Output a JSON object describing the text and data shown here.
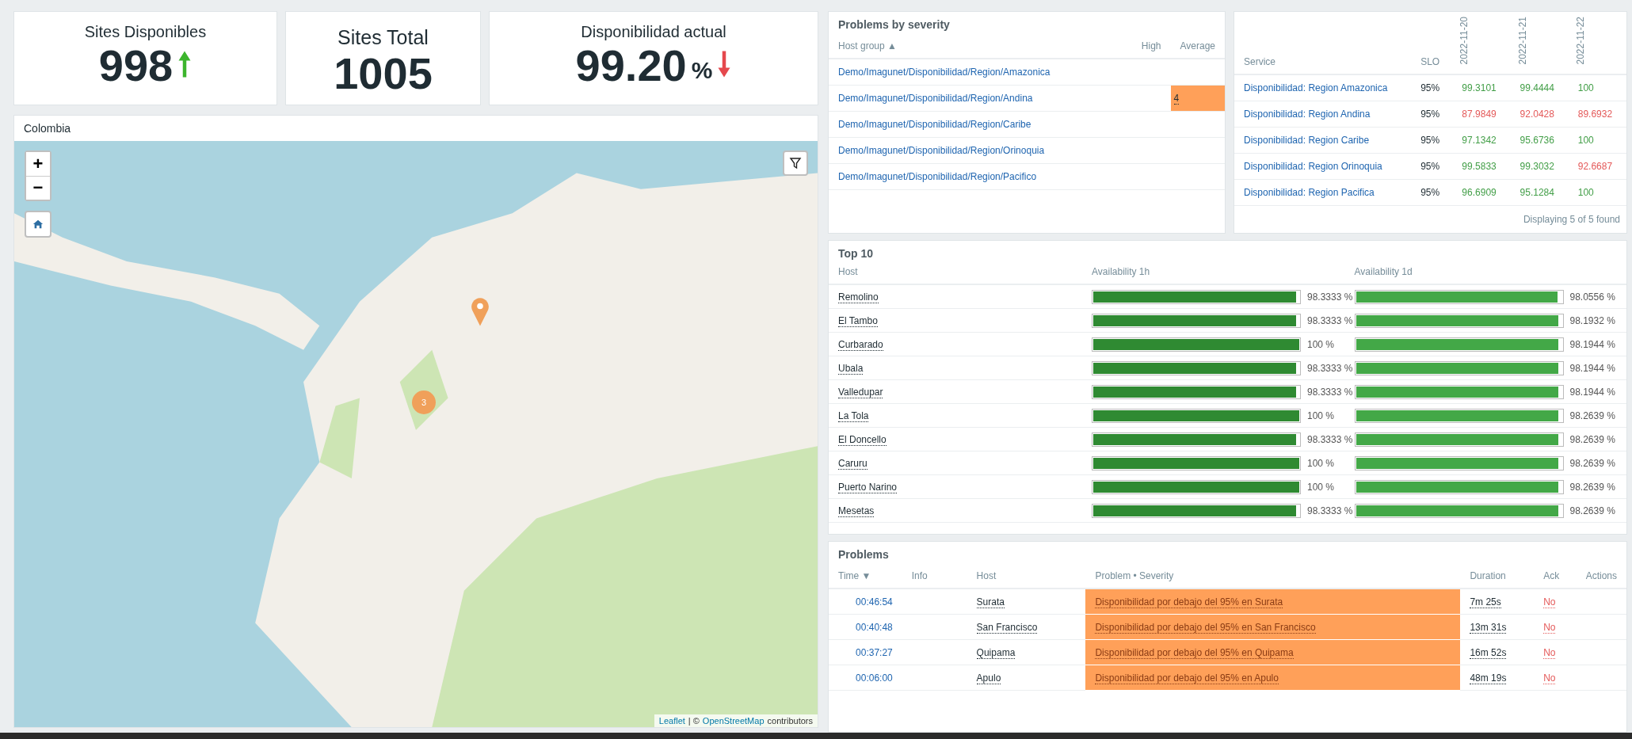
{
  "metrics": [
    {
      "title": "Sites Disponibles",
      "value": "998",
      "kind": "rising"
    },
    {
      "title": "Sites Total",
      "value": "1005",
      "kind": "plain"
    },
    {
      "title": "Disponibilidad actual",
      "value": "99.20",
      "unit": "%",
      "kind": "falling"
    }
  ],
  "map": {
    "title": "Colombia",
    "zoom_in": "+",
    "zoom_out": "−",
    "cluster_count": "3",
    "attribution_link": "Leaflet",
    "attribution_sep": "| ©",
    "attribution_osm": "OpenStreetMap",
    "attribution_rest": "contributors"
  },
  "problems_by_severity": {
    "title": "Problems by severity",
    "columns": [
      "Host group ▲",
      "High",
      "Average"
    ],
    "rows": [
      {
        "group": "Demo/Imagunet/Disponibilidad/Region/Amazonica"
      },
      {
        "group": "Demo/Imagunet/Disponibilidad/Region/Andina",
        "average": "4"
      },
      {
        "group": "Demo/Imagunet/Disponibilidad/Region/Caribe"
      },
      {
        "group": "Demo/Imagunet/Disponibilidad/Region/Orinoquia"
      },
      {
        "group": "Demo/Imagunet/Disponibilidad/Region/Pacifico"
      }
    ]
  },
  "sla": {
    "columns": [
      "Service",
      "SLO",
      "2022-11-20",
      "2022-11-21",
      "2022-11-22"
    ],
    "rows": [
      {
        "service": "Disponibilidad: Region Amazonica",
        "slo": "95%",
        "values": [
          {
            "text": "99.3101",
            "below_slo": false
          },
          {
            "text": "99.4444",
            "below_slo": false
          },
          {
            "text": "100",
            "below_slo": false
          }
        ]
      },
      {
        "service": "Disponibilidad: Region Andina",
        "slo": "95%",
        "values": [
          {
            "text": "87.9849",
            "below_slo": true
          },
          {
            "text": "92.0428",
            "below_slo": true
          },
          {
            "text": "89.6932",
            "below_slo": true
          }
        ]
      },
      {
        "service": "Disponibilidad: Region Caribe",
        "slo": "95%",
        "values": [
          {
            "text": "97.1342",
            "below_slo": false
          },
          {
            "text": "95.6736",
            "below_slo": false
          },
          {
            "text": "100",
            "below_slo": false
          }
        ]
      },
      {
        "service": "Disponibilidad: Region Orinoquia",
        "slo": "95%",
        "values": [
          {
            "text": "99.5833",
            "below_slo": false
          },
          {
            "text": "99.3032",
            "below_slo": false
          },
          {
            "text": "92.6687",
            "below_slo": true
          }
        ]
      },
      {
        "service": "Disponibilidad: Region Pacifica",
        "slo": "95%",
        "values": [
          {
            "text": "96.6909",
            "below_slo": false
          },
          {
            "text": "95.1284",
            "below_slo": false
          },
          {
            "text": "100",
            "below_slo": false
          }
        ]
      }
    ],
    "footer": "Displaying 5 of 5 found"
  },
  "top10": {
    "title": "Top 10",
    "columns": [
      "Host",
      "Availability 1h",
      "Availability 1d"
    ],
    "rows": [
      {
        "host": "Remolino",
        "h1": {
          "level": 0.983333,
          "text": "98.3333 %"
        },
        "d1": {
          "level": 0.980556,
          "text": "98.0556 %"
        }
      },
      {
        "host": "El Tambo",
        "h1": {
          "level": 0.983333,
          "text": "98.3333 %"
        },
        "d1": {
          "level": 0.981932,
          "text": "98.1932 %"
        }
      },
      {
        "host": "Curbarado",
        "h1": {
          "level": 1,
          "text": "100 %"
        },
        "d1": {
          "level": 0.981944,
          "text": "98.1944 %"
        }
      },
      {
        "host": "Ubala",
        "h1": {
          "level": 0.983333,
          "text": "98.3333 %"
        },
        "d1": {
          "level": 0.981944,
          "text": "98.1944 %"
        }
      },
      {
        "host": "Valledupar",
        "h1": {
          "level": 0.983333,
          "text": "98.3333 %"
        },
        "d1": {
          "level": 0.981944,
          "text": "98.1944 %"
        }
      },
      {
        "host": "La Tola",
        "h1": {
          "level": 1,
          "text": "100 %"
        },
        "d1": {
          "level": 0.982639,
          "text": "98.2639 %"
        }
      },
      {
        "host": "El Doncello",
        "h1": {
          "level": 0.983333,
          "text": "98.3333 %"
        },
        "d1": {
          "level": 0.982639,
          "text": "98.2639 %"
        }
      },
      {
        "host": "Caruru",
        "h1": {
          "level": 1,
          "text": "100 %"
        },
        "d1": {
          "level": 0.982639,
          "text": "98.2639 %"
        }
      },
      {
        "host": "Puerto Narino",
        "h1": {
          "level": 1,
          "text": "100 %"
        },
        "d1": {
          "level": 0.982639,
          "text": "98.2639 %"
        }
      },
      {
        "host": "Mesetas",
        "h1": {
          "level": 0.983333,
          "text": "98.3333 %"
        },
        "d1": {
          "level": 0.982639,
          "text": "98.2639 %"
        }
      }
    ]
  },
  "problems": {
    "title": "Problems",
    "columns": [
      "Time ▼",
      "Info",
      "Host",
      "Problem • Severity",
      "Duration",
      "Ack",
      "Actions"
    ],
    "rows": [
      {
        "time": "00:46:54",
        "host": "Surata",
        "problem": "Disponibilidad por debajo del 95% en Surata",
        "duration": "7m 25s",
        "ack": "No"
      },
      {
        "time": "00:40:48",
        "host": "San Francisco",
        "problem": "Disponibilidad por debajo del 95% en San Francisco",
        "duration": "13m 31s",
        "ack": "No"
      },
      {
        "time": "00:37:27",
        "host": "Quipama",
        "problem": "Disponibilidad por debajo del 95% en Quipama",
        "duration": "16m 52s",
        "ack": "No"
      },
      {
        "time": "00:06:00",
        "host": "Apulo",
        "problem": "Disponibilidad por debajo del 95% en Apulo",
        "duration": "48m 19s",
        "ack": "No"
      }
    ]
  }
}
